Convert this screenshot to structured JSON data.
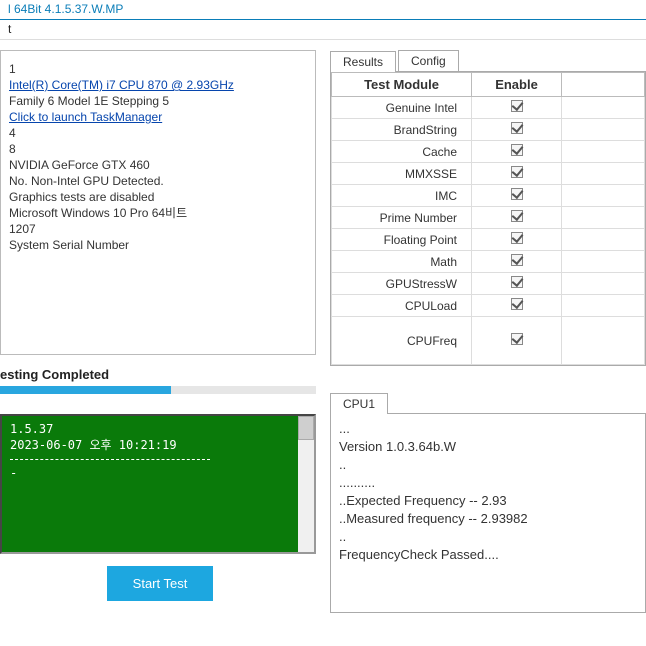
{
  "title": "l 64Bit 4.1.5.37.W.MP",
  "menu_fragment": "t",
  "info": {
    "l1": "1",
    "cpu_link": "Intel(R) Core(TM) i7 CPU         870  @ 2.93GHz",
    "l3": "Family 6 Model 1E Stepping 5",
    "tm_link": "Click to launch TaskManager",
    "l5": "4",
    "l6": "8",
    "l7": "NVIDIA GeForce GTX 460",
    "l8": "No. Non-Intel GPU Detected.",
    "l9": "Graphics tests are disabled",
    "l10": "Microsoft Windows 10 Pro 64비트",
    "l11": "1207",
    "l12": "System Serial Number"
  },
  "status_label": "esting Completed",
  "console": {
    "l1": "1.5.37",
    "l2": "2023-06-07 오후 10:21:19",
    "l3": "-"
  },
  "start_btn": "Start Test",
  "tabs": {
    "results": "Results",
    "config": "Config"
  },
  "grid_cols": {
    "module": "Test Module",
    "enable": "Enable"
  },
  "modules": [
    {
      "name": "Genuine Intel",
      "enabled": true
    },
    {
      "name": "BrandString",
      "enabled": true
    },
    {
      "name": "Cache",
      "enabled": true
    },
    {
      "name": "MMXSSE",
      "enabled": true
    },
    {
      "name": "IMC",
      "enabled": true
    },
    {
      "name": "Prime Number",
      "enabled": true
    },
    {
      "name": "Floating Point",
      "enabled": true
    },
    {
      "name": "Math",
      "enabled": true
    },
    {
      "name": "GPUStressW",
      "enabled": true
    },
    {
      "name": "CPULoad",
      "enabled": true
    },
    {
      "name": "CPUFreq",
      "enabled": true
    }
  ],
  "cpu_tab": "CPU1",
  "cpu_out": {
    "l1": "...",
    "l2": "Version 1.0.3.64b.W",
    "l3": "..",
    "l4": "..........",
    "l5": "..Expected Frequency -- 2.93",
    "l6": "..Measured frequency -- 2.93982",
    "l7": "..",
    "l8": "",
    "l9": "FrequencyCheck Passed...."
  },
  "chart_data": {
    "type": "table",
    "title": "Test Module Enable States",
    "columns": [
      "Test Module",
      "Enable"
    ],
    "rows": [
      [
        "Genuine Intel",
        true
      ],
      [
        "BrandString",
        true
      ],
      [
        "Cache",
        true
      ],
      [
        "MMXSSE",
        true
      ],
      [
        "IMC",
        true
      ],
      [
        "Prime Number",
        true
      ],
      [
        "Floating Point",
        true
      ],
      [
        "Math",
        true
      ],
      [
        "GPUStressW",
        true
      ],
      [
        "CPULoad",
        true
      ],
      [
        "CPUFreq",
        true
      ]
    ]
  }
}
